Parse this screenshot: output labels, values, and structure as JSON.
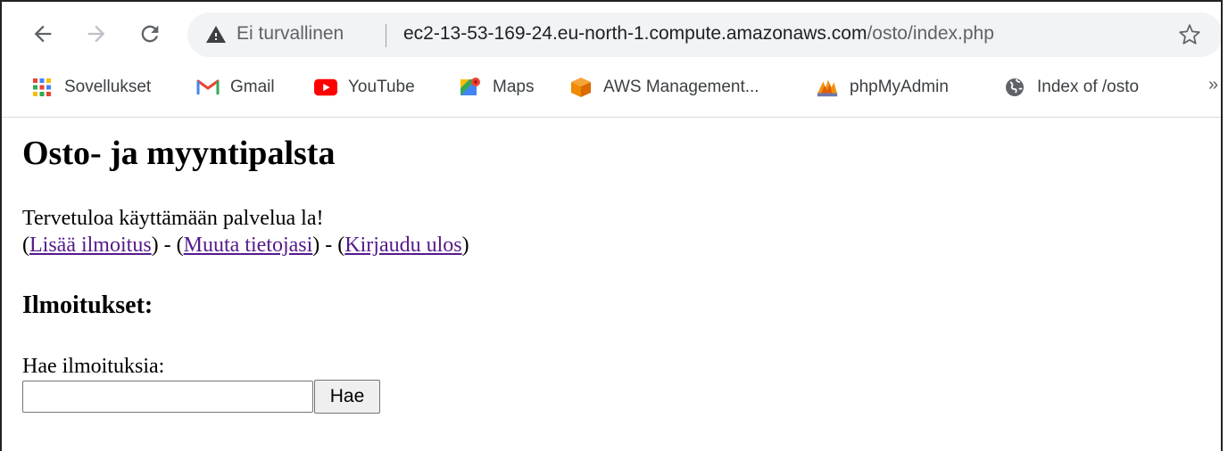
{
  "browser": {
    "security_label": "Ei turvallinen",
    "url_host": "ec2-13-53-169-24.eu-north-1.compute.amazonaws.com",
    "url_path": "/osto/index.php"
  },
  "bookmarks": [
    {
      "label": "Sovellukset",
      "icon": "apps-grid-icon"
    },
    {
      "label": "Gmail",
      "icon": "gmail-icon"
    },
    {
      "label": "YouTube",
      "icon": "youtube-icon"
    },
    {
      "label": "Maps",
      "icon": "maps-icon"
    },
    {
      "label": "AWS Management...",
      "icon": "aws-cube-icon"
    },
    {
      "label": "phpMyAdmin",
      "icon": "phpmyadmin-icon"
    },
    {
      "label": "Index of /osto",
      "icon": "globe-icon"
    }
  ],
  "bookmarks_more": "»",
  "page": {
    "title": "Osto- ja myyntipalsta",
    "welcome": "Tervetuloa käyttämään palvelua la!",
    "links": {
      "add": "Lisää ilmoitus",
      "edit": "Muuta tietojasi",
      "logout": "Kirjaudu ulos"
    },
    "listings_heading": "Ilmoitukset:",
    "search_label": "Hae ilmoituksia:",
    "search_value": "",
    "search_button": "Hae"
  },
  "colors": {
    "link_visited": "#551a8b",
    "omnibox_bg": "#f1f3f4"
  }
}
